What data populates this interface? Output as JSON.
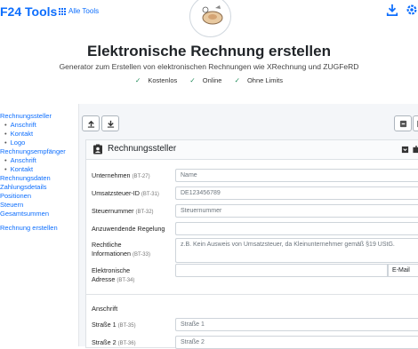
{
  "header": {
    "brand": "F24 Tools",
    "all_tools": "Alle Tools"
  },
  "hero": {
    "title": "Elektronische Rechnung erstellen",
    "subtitle": "Generator zum Erstellen von elektronischen Rechnungen wie XRechnung und ZUGFeRD",
    "features": [
      "Kostenlos",
      "Online",
      "Ohne Limits"
    ]
  },
  "sidebar": {
    "items": [
      {
        "label": "Rechnungssteller",
        "sub": false
      },
      {
        "label": "Anschrift",
        "sub": true
      },
      {
        "label": "Kontakt",
        "sub": true
      },
      {
        "label": "Logo",
        "sub": true
      },
      {
        "label": "Rechnungsempfänger",
        "sub": false
      },
      {
        "label": "Anschrift",
        "sub": true
      },
      {
        "label": "Kontakt",
        "sub": true
      },
      {
        "label": "Rechnungsdaten",
        "sub": false
      },
      {
        "label": "Zahlungsdetails",
        "sub": false
      },
      {
        "label": "Positionen",
        "sub": false
      },
      {
        "label": "Steuern",
        "sub": false
      },
      {
        "label": "Gesamtsummen",
        "sub": false
      }
    ],
    "create_label": "Rechnung erstellen"
  },
  "card": {
    "title": "Rechnungssteller",
    "fields": {
      "company": {
        "label": "Unternehmen",
        "bt": "(BT-27)",
        "placeholder": "Name"
      },
      "vat_id": {
        "label": "Umsatzsteuer-ID",
        "bt": "(BT-31)",
        "placeholder": "DE123456789"
      },
      "tax_no": {
        "label": "Steuernummer",
        "bt": "(BT-32)",
        "placeholder": "Steuernummer"
      },
      "regulation": {
        "label": "Anzuwendende Regelung",
        "value": ""
      },
      "legal_info": {
        "label1": "Rechtliche",
        "label2": "Informationen",
        "bt": "(BT-33)",
        "placeholder": "z.B. Kein Ausweis von Umsatzsteuer, da Kleinunternehmer gemäß §19 UStG."
      },
      "e_address": {
        "label1": "Elektronische",
        "label2": "Adresse",
        "bt": "(BT-34)",
        "placeholder": "",
        "type": "E-Mail"
      }
    },
    "address_section": {
      "title": "Anschrift",
      "street1": {
        "label": "Straße 1",
        "bt": "(BT-35)",
        "placeholder": "Straße 1"
      },
      "street2": {
        "label": "Straße 2",
        "bt": "(BT-36)",
        "placeholder": "Straße 2"
      }
    }
  },
  "colors": {
    "accent": "#0d6efd",
    "check": "#198754"
  }
}
